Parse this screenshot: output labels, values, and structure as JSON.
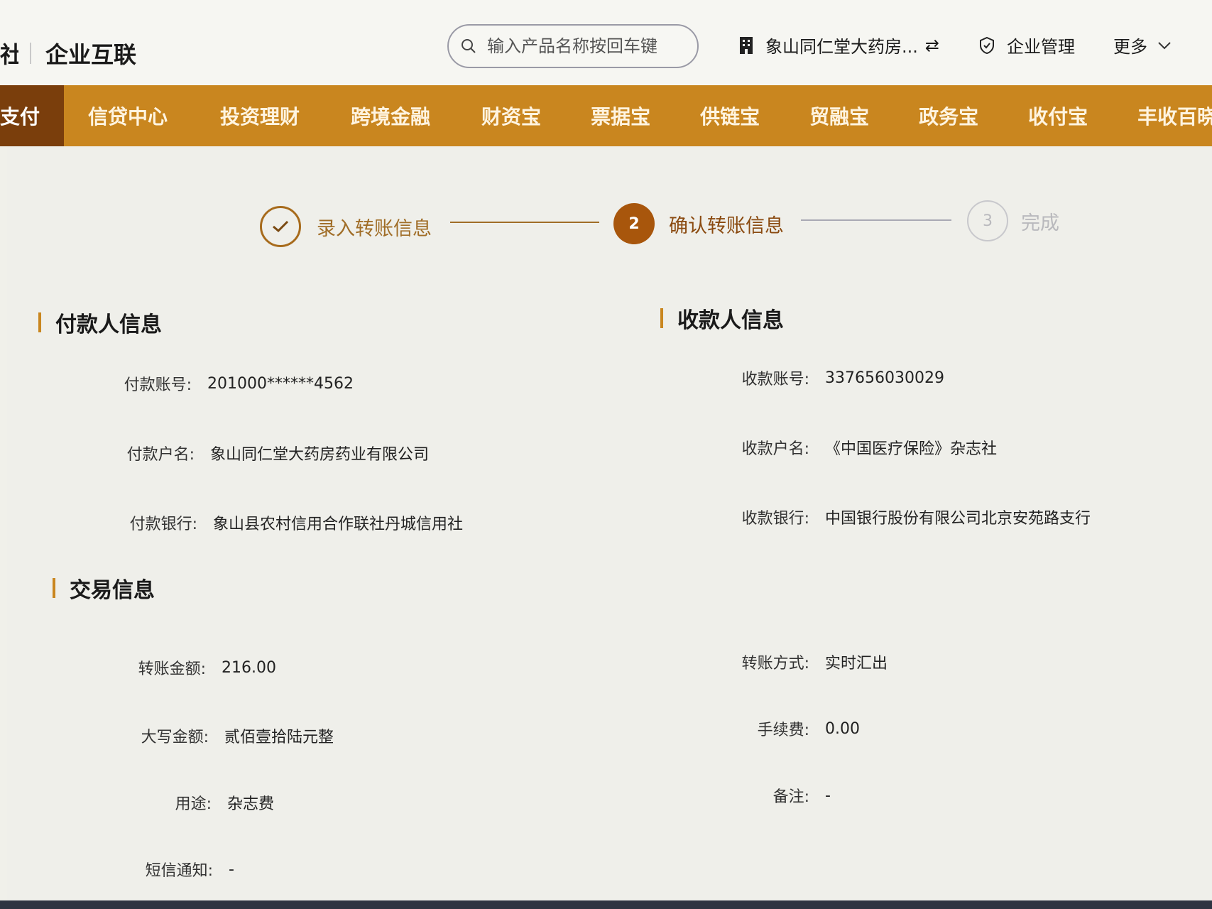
{
  "header": {
    "brand_partial": "社",
    "brand_title": "企业互联",
    "search_placeholder": "输入产品名称按回车键",
    "company_name": "象山同仁堂大药房...",
    "swap_symbol": "⇄",
    "enterprise_management": "企业管理",
    "more": "更多"
  },
  "nav": {
    "items": [
      {
        "label": "支付"
      },
      {
        "label": "信贷中心"
      },
      {
        "label": "投资理财"
      },
      {
        "label": "跨境金融"
      },
      {
        "label": "财资宝"
      },
      {
        "label": "票据宝"
      },
      {
        "label": "供链宝"
      },
      {
        "label": "贸融宝"
      },
      {
        "label": "政务宝"
      },
      {
        "label": "收付宝"
      },
      {
        "label": "丰收百晓"
      }
    ]
  },
  "steps": [
    {
      "label": "录入转账信息",
      "number": ""
    },
    {
      "label": "确认转账信息",
      "number": "2"
    },
    {
      "label": "完成",
      "number": "3"
    }
  ],
  "payer": {
    "title": "付款人信息",
    "account_label": "付款账号:",
    "account_value": "201000******4562",
    "name_label": "付款户名:",
    "name_value": "象山同仁堂大药房药业有限公司",
    "bank_label": "付款银行:",
    "bank_value": "象山县农村信用合作联社丹城信用社"
  },
  "payee": {
    "title": "收款人信息",
    "account_label": "收款账号:",
    "account_value": "337656030029",
    "name_label": "收款户名:",
    "name_value": "《中国医疗保险》杂志社",
    "bank_label": "收款银行:",
    "bank_value": "中国银行股份有限公司北京安苑路支行"
  },
  "transaction": {
    "title": "交易信息",
    "amount_label": "转账金额:",
    "amount_value": "216.00",
    "amount_words_label": "大写金额:",
    "amount_words_value": "贰佰壹拾陆元整",
    "purpose_label": "用途:",
    "purpose_value": "杂志费",
    "sms_label": "短信通知:",
    "sms_value": "-",
    "method_label": "转账方式:",
    "method_value": "实时汇出",
    "fee_label": "手续费:",
    "fee_value": "0.00",
    "remark_label": "备注:",
    "remark_value": "-"
  },
  "colors": {
    "nav_bg": "#c9861f",
    "nav_active": "#7a3e0c",
    "step_active": "#a8560c",
    "accent_bar": "#c9861f"
  }
}
